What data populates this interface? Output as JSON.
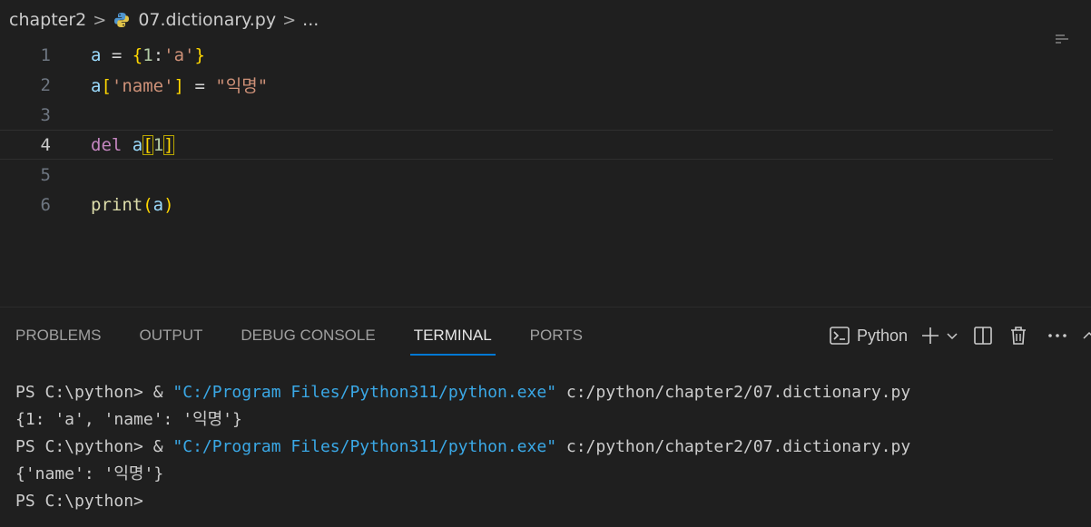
{
  "breadcrumb": {
    "folder": "chapter2",
    "separator": ">",
    "file": "07.dictionary.py",
    "ellipsis": "..."
  },
  "editor": {
    "active_line": 4,
    "line_numbers": [
      "1",
      "2",
      "3",
      "4",
      "5",
      "6"
    ],
    "lines": [
      [
        {
          "t": "a",
          "c": "v"
        },
        {
          "t": " = ",
          "c": "p"
        },
        {
          "t": "{",
          "c": "br1"
        },
        {
          "t": "1",
          "c": "n"
        },
        {
          "t": ":",
          "c": "p"
        },
        {
          "t": "'a'",
          "c": "s"
        },
        {
          "t": "}",
          "c": "br1"
        }
      ],
      [
        {
          "t": "a",
          "c": "v"
        },
        {
          "t": "[",
          "c": "br1"
        },
        {
          "t": "'name'",
          "c": "s"
        },
        {
          "t": "]",
          "c": "br1"
        },
        {
          "t": " = ",
          "c": "p"
        },
        {
          "t": "\"익명\"",
          "c": "s"
        }
      ],
      [],
      [
        {
          "t": "del",
          "c": "k"
        },
        {
          "t": " ",
          "c": "p"
        },
        {
          "t": "a",
          "c": "v"
        },
        {
          "t": "[",
          "c": "br1 bm"
        },
        {
          "t": "1",
          "c": "n"
        },
        {
          "t": "]",
          "c": "br1 bm"
        }
      ],
      [],
      [
        {
          "t": "print",
          "c": "f"
        },
        {
          "t": "(",
          "c": "br1"
        },
        {
          "t": "a",
          "c": "v"
        },
        {
          "t": ")",
          "c": "br1"
        }
      ]
    ]
  },
  "panel": {
    "tabs": [
      {
        "label": "PROBLEMS",
        "active": false
      },
      {
        "label": "OUTPUT",
        "active": false
      },
      {
        "label": "DEBUG CONSOLE",
        "active": false
      },
      {
        "label": "TERMINAL",
        "active": true
      },
      {
        "label": "PORTS",
        "active": false
      }
    ],
    "terminal_profile": "Python",
    "icons": [
      "terminal-icon",
      "plus-icon",
      "chevron-down-icon",
      "split-icon",
      "trash-icon",
      "more-icon",
      "chevron-up-icon"
    ]
  },
  "terminal": {
    "lines": [
      [
        {
          "t": "PS C:\\python> & ",
          "c": ""
        },
        {
          "t": "\"C:/Program Files/Python311/python.exe\"",
          "c": "str"
        },
        {
          "t": " c:/python/chapter2/07.dictionary.py",
          "c": ""
        }
      ],
      [
        {
          "t": "{1: 'a', 'name': '익명'}",
          "c": ""
        }
      ],
      [
        {
          "t": "PS C:\\python> & ",
          "c": ""
        },
        {
          "t": "\"C:/Program Files/Python311/python.exe\"",
          "c": "str"
        },
        {
          "t": " c:/python/chapter2/07.dictionary.py",
          "c": ""
        }
      ],
      [
        {
          "t": "{'name': '익명'}",
          "c": ""
        }
      ],
      [
        {
          "t": "PS C:\\python>",
          "c": ""
        }
      ]
    ]
  },
  "colors": {
    "background": "#1f1f1f",
    "active_tab_underline": "#0078d4",
    "terminal_string": "#3aa8e6"
  }
}
